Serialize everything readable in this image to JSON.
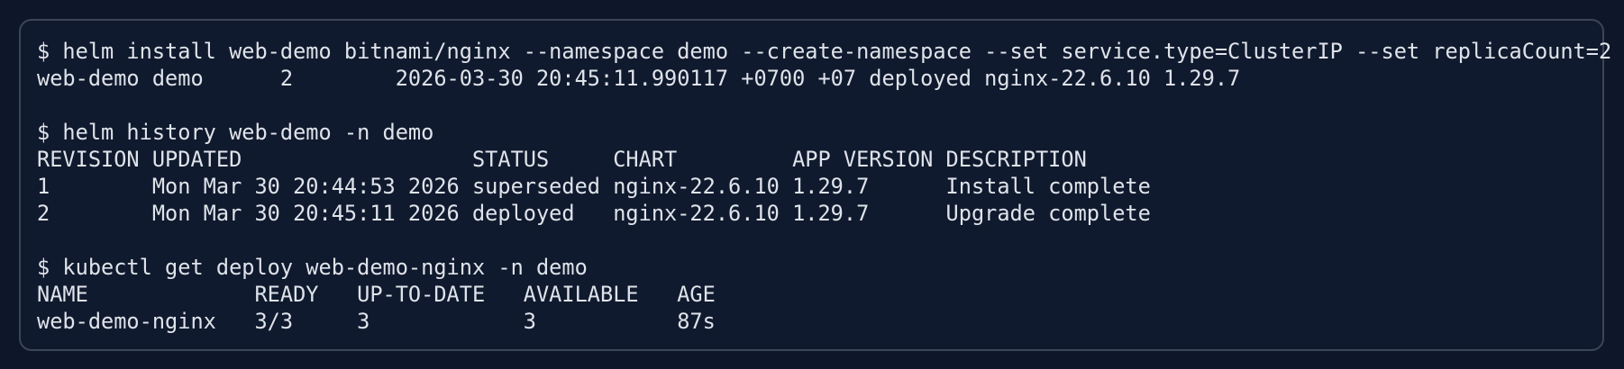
{
  "terminal": {
    "blocks": [
      {
        "command": "$ helm install web-demo bitnami/nginx --namespace demo --create-namespace --set service.type=ClusterIP --set replicaCount=2",
        "output": [
          "web-demo demo      2        2026-03-30 20:45:11.990117 +0700 +07 deployed nginx-22.6.10 1.29.7"
        ]
      },
      {
        "command": "$ helm history web-demo -n demo",
        "output": [
          "REVISION UPDATED                  STATUS     CHART         APP VERSION DESCRIPTION",
          "1        Mon Mar 30 20:44:53 2026 superseded nginx-22.6.10 1.29.7      Install complete",
          "2        Mon Mar 30 20:45:11 2026 deployed   nginx-22.6.10 1.29.7      Upgrade complete"
        ]
      },
      {
        "command": "$ kubectl get deploy web-demo-nginx -n demo",
        "output": [
          "NAME             READY   UP-TO-DATE   AVAILABLE   AGE",
          "web-demo-nginx   3/3     3            3           87s"
        ]
      }
    ]
  }
}
